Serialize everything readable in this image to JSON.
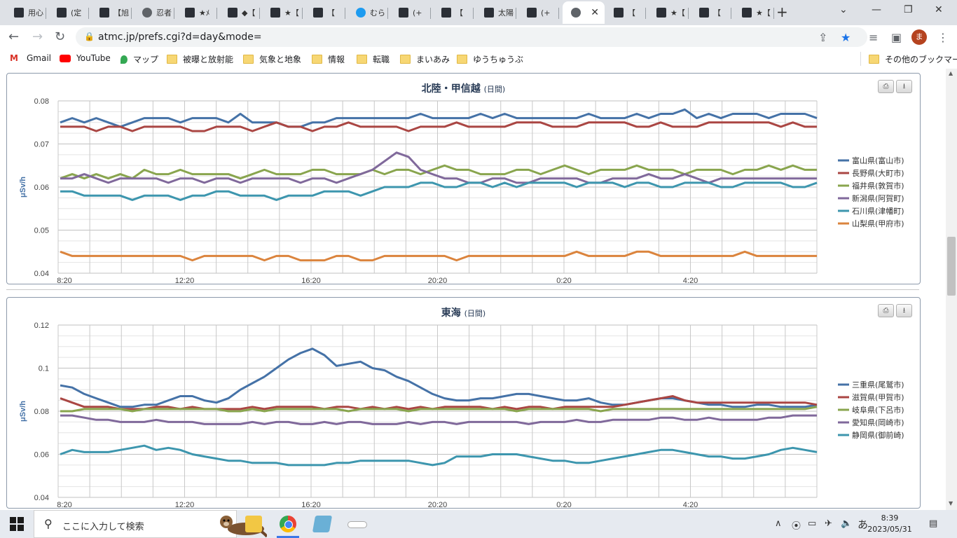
{
  "tabs": [
    {
      "label": "用心"
    },
    {
      "label": "(定"
    },
    {
      "label": "【旭"
    },
    {
      "label": "忍者"
    },
    {
      "label": "★ﾒ"
    },
    {
      "label": "◆【"
    },
    {
      "label": "★【"
    },
    {
      "label": "【 "
    },
    {
      "label": "むら"
    },
    {
      "label": "(+"
    },
    {
      "label": "【 "
    },
    {
      "label": "太陽"
    },
    {
      "label": "(+"
    },
    {
      "label": ""
    },
    {
      "label": "【 "
    },
    {
      "label": "★【"
    },
    {
      "label": "【 "
    },
    {
      "label": "★【"
    }
  ],
  "address": {
    "url": "atmc.jp/prefs.cgi?d=day&mode="
  },
  "profile": {
    "initial": "ま"
  },
  "bookmarks": [
    {
      "label": "Gmail"
    },
    {
      "label": "YouTube"
    },
    {
      "label": "マップ"
    },
    {
      "label": "被曝と放射能"
    },
    {
      "label": "気象と地象"
    },
    {
      "label": "情報"
    },
    {
      "label": "転職"
    },
    {
      "label": "まいあみ"
    },
    {
      "label": "ゆうちゅうぶ"
    },
    {
      "label": "その他のブックマーク"
    }
  ],
  "chart_data": [
    {
      "type": "line",
      "title": "北陸・甲信越",
      "title_suffix": "(日間)",
      "ylabel": "μSv/h",
      "ylim": [
        0.04,
        0.08
      ],
      "yticks": [
        "0.08",
        "0.07",
        "0.06",
        "0.05",
        "0.04"
      ],
      "xticks": [
        "8:20",
        "12:20",
        "16:20",
        "20:20",
        "0:20",
        "4:20"
      ],
      "grid": true,
      "legend_position": "right",
      "series": [
        {
          "name": "富山県(富山市)",
          "color": "#4572a7",
          "values": [
            0.075,
            0.076,
            0.075,
            0.076,
            0.075,
            0.074,
            0.075,
            0.076,
            0.076,
            0.076,
            0.075,
            0.076,
            0.076,
            0.076,
            0.075,
            0.077,
            0.075,
            0.075,
            0.075,
            0.074,
            0.074,
            0.075,
            0.075,
            0.076,
            0.076,
            0.076,
            0.076,
            0.076,
            0.076,
            0.076,
            0.077,
            0.076,
            0.076,
            0.076,
            0.076,
            0.077,
            0.076,
            0.077,
            0.076,
            0.076,
            0.076,
            0.076,
            0.076,
            0.076,
            0.077,
            0.076,
            0.076,
            0.076,
            0.077,
            0.076,
            0.077,
            0.077,
            0.078,
            0.076,
            0.077,
            0.076,
            0.077,
            0.077,
            0.077,
            0.076,
            0.077,
            0.077,
            0.077,
            0.076
          ]
        },
        {
          "name": "長野県(大町市)",
          "color": "#aa4643",
          "values": [
            0.074,
            0.074,
            0.074,
            0.073,
            0.074,
            0.074,
            0.073,
            0.074,
            0.074,
            0.074,
            0.074,
            0.073,
            0.073,
            0.074,
            0.074,
            0.074,
            0.073,
            0.074,
            0.075,
            0.074,
            0.074,
            0.073,
            0.074,
            0.074,
            0.075,
            0.074,
            0.074,
            0.074,
            0.074,
            0.073,
            0.074,
            0.074,
            0.074,
            0.075,
            0.074,
            0.074,
            0.074,
            0.074,
            0.075,
            0.075,
            0.075,
            0.074,
            0.074,
            0.074,
            0.075,
            0.075,
            0.075,
            0.075,
            0.074,
            0.074,
            0.075,
            0.074,
            0.074,
            0.074,
            0.075,
            0.075,
            0.075,
            0.075,
            0.075,
            0.075,
            0.074,
            0.075,
            0.074,
            0.074
          ]
        },
        {
          "name": "福井県(敦賀市)",
          "color": "#89a54e",
          "values": [
            0.062,
            0.063,
            0.062,
            0.063,
            0.062,
            0.063,
            0.062,
            0.064,
            0.063,
            0.063,
            0.064,
            0.063,
            0.063,
            0.063,
            0.063,
            0.062,
            0.063,
            0.064,
            0.063,
            0.063,
            0.063,
            0.064,
            0.064,
            0.063,
            0.063,
            0.063,
            0.064,
            0.063,
            0.064,
            0.064,
            0.063,
            0.064,
            0.065,
            0.064,
            0.064,
            0.063,
            0.063,
            0.063,
            0.064,
            0.064,
            0.063,
            0.064,
            0.065,
            0.064,
            0.063,
            0.064,
            0.064,
            0.064,
            0.065,
            0.064,
            0.064,
            0.064,
            0.063,
            0.064,
            0.064,
            0.064,
            0.063,
            0.064,
            0.064,
            0.065,
            0.064,
            0.065,
            0.064,
            0.064
          ]
        },
        {
          "name": "新潟県(阿賀町)",
          "color": "#80699b",
          "values": [
            0.062,
            0.062,
            0.063,
            0.062,
            0.061,
            0.062,
            0.062,
            0.062,
            0.062,
            0.061,
            0.062,
            0.062,
            0.061,
            0.062,
            0.062,
            0.061,
            0.062,
            0.062,
            0.062,
            0.062,
            0.061,
            0.062,
            0.062,
            0.061,
            0.062,
            0.063,
            0.064,
            0.066,
            0.068,
            0.067,
            0.064,
            0.063,
            0.062,
            0.062,
            0.061,
            0.061,
            0.062,
            0.062,
            0.061,
            0.061,
            0.062,
            0.062,
            0.062,
            0.062,
            0.061,
            0.061,
            0.062,
            0.062,
            0.062,
            0.063,
            0.062,
            0.062,
            0.063,
            0.062,
            0.061,
            0.062,
            0.062,
            0.062,
            0.062,
            0.062,
            0.062,
            0.062,
            0.062,
            0.062
          ]
        },
        {
          "name": "石川県(津幡町)",
          "color": "#3d96ae",
          "values": [
            0.059,
            0.059,
            0.058,
            0.058,
            0.058,
            0.058,
            0.057,
            0.058,
            0.058,
            0.058,
            0.057,
            0.058,
            0.058,
            0.059,
            0.059,
            0.058,
            0.058,
            0.058,
            0.057,
            0.058,
            0.058,
            0.058,
            0.059,
            0.059,
            0.059,
            0.058,
            0.059,
            0.06,
            0.06,
            0.06,
            0.061,
            0.061,
            0.06,
            0.06,
            0.061,
            0.061,
            0.06,
            0.061,
            0.06,
            0.061,
            0.061,
            0.061,
            0.061,
            0.06,
            0.061,
            0.061,
            0.061,
            0.06,
            0.061,
            0.061,
            0.06,
            0.06,
            0.061,
            0.061,
            0.061,
            0.06,
            0.06,
            0.061,
            0.061,
            0.061,
            0.061,
            0.06,
            0.06,
            0.061
          ]
        },
        {
          "name": "山梨県(甲府市)",
          "color": "#db843d",
          "values": [
            0.045,
            0.044,
            0.044,
            0.044,
            0.044,
            0.044,
            0.044,
            0.044,
            0.044,
            0.044,
            0.044,
            0.043,
            0.044,
            0.044,
            0.044,
            0.044,
            0.044,
            0.043,
            0.044,
            0.044,
            0.043,
            0.043,
            0.043,
            0.044,
            0.044,
            0.043,
            0.043,
            0.044,
            0.044,
            0.044,
            0.044,
            0.044,
            0.044,
            0.043,
            0.044,
            0.044,
            0.044,
            0.044,
            0.044,
            0.044,
            0.044,
            0.044,
            0.044,
            0.045,
            0.044,
            0.044,
            0.044,
            0.044,
            0.045,
            0.045,
            0.044,
            0.044,
            0.044,
            0.044,
            0.044,
            0.044,
            0.044,
            0.045,
            0.044,
            0.044,
            0.044,
            0.044,
            0.044,
            0.044
          ]
        }
      ]
    },
    {
      "type": "line",
      "title": "東海",
      "title_suffix": "(日間)",
      "ylabel": "μSv/h",
      "ylim": [
        0.04,
        0.12
      ],
      "yticks": [
        "0.12",
        "0.1",
        "0.08",
        "0.06",
        "0.04"
      ],
      "xticks": [
        "8:20",
        "12:20",
        "16:20",
        "20:20",
        "0:20",
        "4:20"
      ],
      "grid": true,
      "legend_position": "right",
      "series": [
        {
          "name": "三重県(尾鷲市)",
          "color": "#4572a7",
          "values": [
            0.092,
            0.091,
            0.088,
            0.086,
            0.084,
            0.082,
            0.082,
            0.083,
            0.083,
            0.085,
            0.087,
            0.087,
            0.085,
            0.084,
            0.086,
            0.09,
            0.093,
            0.096,
            0.1,
            0.104,
            0.107,
            0.109,
            0.106,
            0.101,
            0.102,
            0.103,
            0.1,
            0.099,
            0.096,
            0.094,
            0.091,
            0.088,
            0.086,
            0.085,
            0.085,
            0.086,
            0.086,
            0.087,
            0.088,
            0.088,
            0.087,
            0.086,
            0.085,
            0.085,
            0.086,
            0.084,
            0.083,
            0.083,
            0.084,
            0.085,
            0.086,
            0.086,
            0.085,
            0.084,
            0.083,
            0.083,
            0.082,
            0.082,
            0.083,
            0.083,
            0.082,
            0.082,
            0.082,
            0.083
          ]
        },
        {
          "name": "滋賀県(甲賀市)",
          "color": "#aa4643",
          "values": [
            0.086,
            0.084,
            0.082,
            0.082,
            0.082,
            0.081,
            0.081,
            0.081,
            0.082,
            0.082,
            0.081,
            0.082,
            0.081,
            0.081,
            0.081,
            0.081,
            0.082,
            0.081,
            0.082,
            0.082,
            0.082,
            0.082,
            0.081,
            0.082,
            0.082,
            0.081,
            0.082,
            0.081,
            0.082,
            0.081,
            0.082,
            0.081,
            0.082,
            0.082,
            0.082,
            0.082,
            0.081,
            0.082,
            0.081,
            0.082,
            0.082,
            0.081,
            0.082,
            0.082,
            0.082,
            0.082,
            0.082,
            0.083,
            0.084,
            0.085,
            0.086,
            0.087,
            0.085,
            0.084,
            0.084,
            0.084,
            0.084,
            0.084,
            0.084,
            0.084,
            0.084,
            0.084,
            0.084,
            0.083
          ]
        },
        {
          "name": "岐阜県(下呂市)",
          "color": "#89a54e",
          "values": [
            0.08,
            0.08,
            0.081,
            0.081,
            0.081,
            0.081,
            0.08,
            0.081,
            0.081,
            0.081,
            0.081,
            0.081,
            0.081,
            0.081,
            0.08,
            0.08,
            0.081,
            0.08,
            0.081,
            0.081,
            0.081,
            0.081,
            0.081,
            0.081,
            0.08,
            0.081,
            0.081,
            0.081,
            0.081,
            0.08,
            0.081,
            0.081,
            0.081,
            0.081,
            0.081,
            0.081,
            0.081,
            0.081,
            0.08,
            0.081,
            0.081,
            0.081,
            0.081,
            0.081,
            0.081,
            0.08,
            0.081,
            0.081,
            0.081,
            0.081,
            0.081,
            0.081,
            0.081,
            0.081,
            0.081,
            0.081,
            0.081,
            0.081,
            0.081,
            0.081,
            0.081,
            0.081,
            0.081,
            0.082
          ]
        },
        {
          "name": "愛知県(岡崎市)",
          "color": "#80699b",
          "values": [
            0.078,
            0.078,
            0.077,
            0.076,
            0.076,
            0.075,
            0.075,
            0.075,
            0.076,
            0.075,
            0.075,
            0.075,
            0.074,
            0.074,
            0.074,
            0.074,
            0.075,
            0.074,
            0.075,
            0.075,
            0.074,
            0.074,
            0.075,
            0.074,
            0.075,
            0.075,
            0.074,
            0.074,
            0.074,
            0.075,
            0.074,
            0.075,
            0.075,
            0.074,
            0.075,
            0.075,
            0.075,
            0.075,
            0.075,
            0.074,
            0.075,
            0.075,
            0.075,
            0.076,
            0.075,
            0.075,
            0.076,
            0.076,
            0.076,
            0.076,
            0.077,
            0.077,
            0.076,
            0.076,
            0.077,
            0.076,
            0.076,
            0.076,
            0.076,
            0.077,
            0.077,
            0.078,
            0.078,
            0.078
          ]
        },
        {
          "name": "静岡県(御前崎)",
          "color": "#3d96ae",
          "values": [
            0.06,
            0.062,
            0.061,
            0.061,
            0.061,
            0.062,
            0.063,
            0.064,
            0.062,
            0.063,
            0.062,
            0.06,
            0.059,
            0.058,
            0.057,
            0.057,
            0.056,
            0.056,
            0.056,
            0.055,
            0.055,
            0.055,
            0.055,
            0.056,
            0.056,
            0.057,
            0.057,
            0.057,
            0.057,
            0.057,
            0.056,
            0.055,
            0.056,
            0.059,
            0.059,
            0.059,
            0.06,
            0.06,
            0.06,
            0.059,
            0.058,
            0.057,
            0.057,
            0.056,
            0.056,
            0.057,
            0.058,
            0.059,
            0.06,
            0.061,
            0.062,
            0.062,
            0.061,
            0.06,
            0.059,
            0.059,
            0.058,
            0.058,
            0.059,
            0.06,
            0.062,
            0.063,
            0.062,
            0.061
          ]
        }
      ]
    }
  ],
  "taskbar": {
    "search_placeholder": "ここに入力して検索",
    "ime": "あ",
    "time": "8:39",
    "date": "2023/05/31"
  }
}
